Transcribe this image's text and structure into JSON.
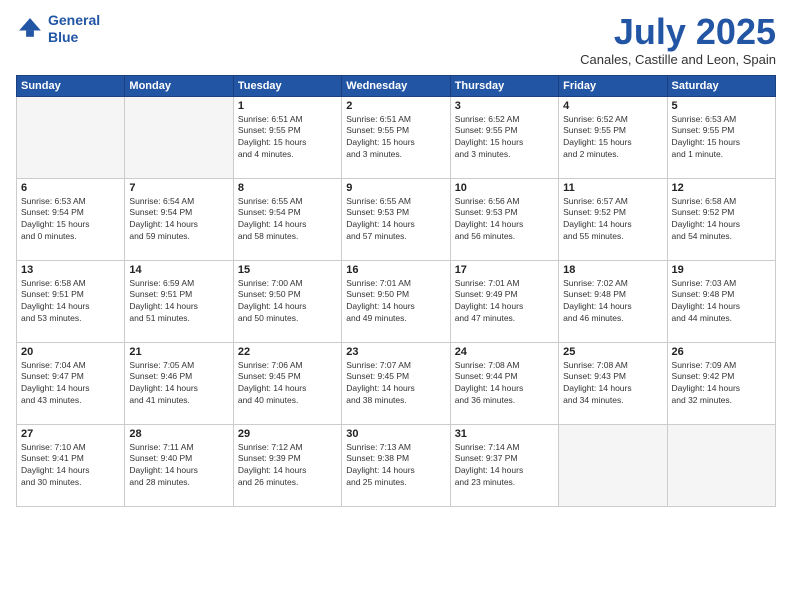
{
  "header": {
    "logo_line1": "General",
    "logo_line2": "Blue",
    "month_title": "July 2025",
    "location": "Canales, Castille and Leon, Spain"
  },
  "weekdays": [
    "Sunday",
    "Monday",
    "Tuesday",
    "Wednesday",
    "Thursday",
    "Friday",
    "Saturday"
  ],
  "weeks": [
    [
      {
        "day": "",
        "info": ""
      },
      {
        "day": "",
        "info": ""
      },
      {
        "day": "1",
        "info": "Sunrise: 6:51 AM\nSunset: 9:55 PM\nDaylight: 15 hours\nand 4 minutes."
      },
      {
        "day": "2",
        "info": "Sunrise: 6:51 AM\nSunset: 9:55 PM\nDaylight: 15 hours\nand 3 minutes."
      },
      {
        "day": "3",
        "info": "Sunrise: 6:52 AM\nSunset: 9:55 PM\nDaylight: 15 hours\nand 3 minutes."
      },
      {
        "day": "4",
        "info": "Sunrise: 6:52 AM\nSunset: 9:55 PM\nDaylight: 15 hours\nand 2 minutes."
      },
      {
        "day": "5",
        "info": "Sunrise: 6:53 AM\nSunset: 9:55 PM\nDaylight: 15 hours\nand 1 minute."
      }
    ],
    [
      {
        "day": "6",
        "info": "Sunrise: 6:53 AM\nSunset: 9:54 PM\nDaylight: 15 hours\nand 0 minutes."
      },
      {
        "day": "7",
        "info": "Sunrise: 6:54 AM\nSunset: 9:54 PM\nDaylight: 14 hours\nand 59 minutes."
      },
      {
        "day": "8",
        "info": "Sunrise: 6:55 AM\nSunset: 9:54 PM\nDaylight: 14 hours\nand 58 minutes."
      },
      {
        "day": "9",
        "info": "Sunrise: 6:55 AM\nSunset: 9:53 PM\nDaylight: 14 hours\nand 57 minutes."
      },
      {
        "day": "10",
        "info": "Sunrise: 6:56 AM\nSunset: 9:53 PM\nDaylight: 14 hours\nand 56 minutes."
      },
      {
        "day": "11",
        "info": "Sunrise: 6:57 AM\nSunset: 9:52 PM\nDaylight: 14 hours\nand 55 minutes."
      },
      {
        "day": "12",
        "info": "Sunrise: 6:58 AM\nSunset: 9:52 PM\nDaylight: 14 hours\nand 54 minutes."
      }
    ],
    [
      {
        "day": "13",
        "info": "Sunrise: 6:58 AM\nSunset: 9:51 PM\nDaylight: 14 hours\nand 53 minutes."
      },
      {
        "day": "14",
        "info": "Sunrise: 6:59 AM\nSunset: 9:51 PM\nDaylight: 14 hours\nand 51 minutes."
      },
      {
        "day": "15",
        "info": "Sunrise: 7:00 AM\nSunset: 9:50 PM\nDaylight: 14 hours\nand 50 minutes."
      },
      {
        "day": "16",
        "info": "Sunrise: 7:01 AM\nSunset: 9:50 PM\nDaylight: 14 hours\nand 49 minutes."
      },
      {
        "day": "17",
        "info": "Sunrise: 7:01 AM\nSunset: 9:49 PM\nDaylight: 14 hours\nand 47 minutes."
      },
      {
        "day": "18",
        "info": "Sunrise: 7:02 AM\nSunset: 9:48 PM\nDaylight: 14 hours\nand 46 minutes."
      },
      {
        "day": "19",
        "info": "Sunrise: 7:03 AM\nSunset: 9:48 PM\nDaylight: 14 hours\nand 44 minutes."
      }
    ],
    [
      {
        "day": "20",
        "info": "Sunrise: 7:04 AM\nSunset: 9:47 PM\nDaylight: 14 hours\nand 43 minutes."
      },
      {
        "day": "21",
        "info": "Sunrise: 7:05 AM\nSunset: 9:46 PM\nDaylight: 14 hours\nand 41 minutes."
      },
      {
        "day": "22",
        "info": "Sunrise: 7:06 AM\nSunset: 9:45 PM\nDaylight: 14 hours\nand 40 minutes."
      },
      {
        "day": "23",
        "info": "Sunrise: 7:07 AM\nSunset: 9:45 PM\nDaylight: 14 hours\nand 38 minutes."
      },
      {
        "day": "24",
        "info": "Sunrise: 7:08 AM\nSunset: 9:44 PM\nDaylight: 14 hours\nand 36 minutes."
      },
      {
        "day": "25",
        "info": "Sunrise: 7:08 AM\nSunset: 9:43 PM\nDaylight: 14 hours\nand 34 minutes."
      },
      {
        "day": "26",
        "info": "Sunrise: 7:09 AM\nSunset: 9:42 PM\nDaylight: 14 hours\nand 32 minutes."
      }
    ],
    [
      {
        "day": "27",
        "info": "Sunrise: 7:10 AM\nSunset: 9:41 PM\nDaylight: 14 hours\nand 30 minutes."
      },
      {
        "day": "28",
        "info": "Sunrise: 7:11 AM\nSunset: 9:40 PM\nDaylight: 14 hours\nand 28 minutes."
      },
      {
        "day": "29",
        "info": "Sunrise: 7:12 AM\nSunset: 9:39 PM\nDaylight: 14 hours\nand 26 minutes."
      },
      {
        "day": "30",
        "info": "Sunrise: 7:13 AM\nSunset: 9:38 PM\nDaylight: 14 hours\nand 25 minutes."
      },
      {
        "day": "31",
        "info": "Sunrise: 7:14 AM\nSunset: 9:37 PM\nDaylight: 14 hours\nand 23 minutes."
      },
      {
        "day": "",
        "info": ""
      },
      {
        "day": "",
        "info": ""
      }
    ]
  ]
}
